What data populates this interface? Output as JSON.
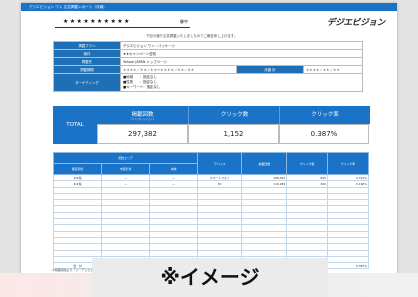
{
  "header_bar": "デジエビジョン ワン 広告掲載レポート（月報）",
  "client": {
    "name": "★★★★★★★★★★",
    "honorific": "御中"
  },
  "logo": "デジエビジョン",
  "notice": "下記の通り広告掲載いたしましたのでご報告申し上げます。",
  "info_rows": [
    {
      "label": "掲載プラン",
      "value": "デジエビジョン ワン・パッケージ"
    },
    {
      "label": "案件",
      "value": "★★キャンペーン告知"
    },
    {
      "label": "掲載先",
      "value": "Yahoo! JAPAN トップページ"
    },
    {
      "label": "掲載期間",
      "value": "＊＊＊＊／＊＊／＊＊〜＊＊＊＊／＊＊／＊＊",
      "extra_label": "月額 計",
      "extra_value": "＊＊＊＊／＊＊／＊＊"
    }
  ],
  "targeting": {
    "label": "ターゲティング",
    "lines": [
      "■地域　　：指定なし",
      "■性別　　：指定なし",
      "■キーワード：指定なし"
    ]
  },
  "kpi": {
    "total_label": "TOTAL",
    "cols": [
      {
        "label": "掲載回数",
        "sub": "（インプレッション）",
        "value": "297,382"
      },
      {
        "label": "クリック数",
        "sub": "",
        "value": "1,152"
      },
      {
        "label": "クリック率",
        "sub": "",
        "value": "0.387%"
      }
    ]
  },
  "detail": {
    "group_header": "配信エリア",
    "headers": [
      "都道府県",
      "市区町村",
      "地域",
      "デバイス",
      "掲載回数",
      "クリック数",
      "クリック率"
    ],
    "rows": [
      [
        "★★県",
        "—",
        "—",
        "スマートフォン",
        "188,093",
        "843",
        "0.312%"
      ],
      [
        "★★県",
        "—",
        "—",
        "PC",
        "110,289",
        "309",
        "0.196%"
      ]
    ],
    "total_row": [
      "合　計",
      "",
      "",
      "",
      "",
      "",
      "0.387%"
    ]
  },
  "footnote": "※掲載開始より「ジ・デジエビジョン」広告掲載レポート",
  "overlay": "※イメージ"
}
